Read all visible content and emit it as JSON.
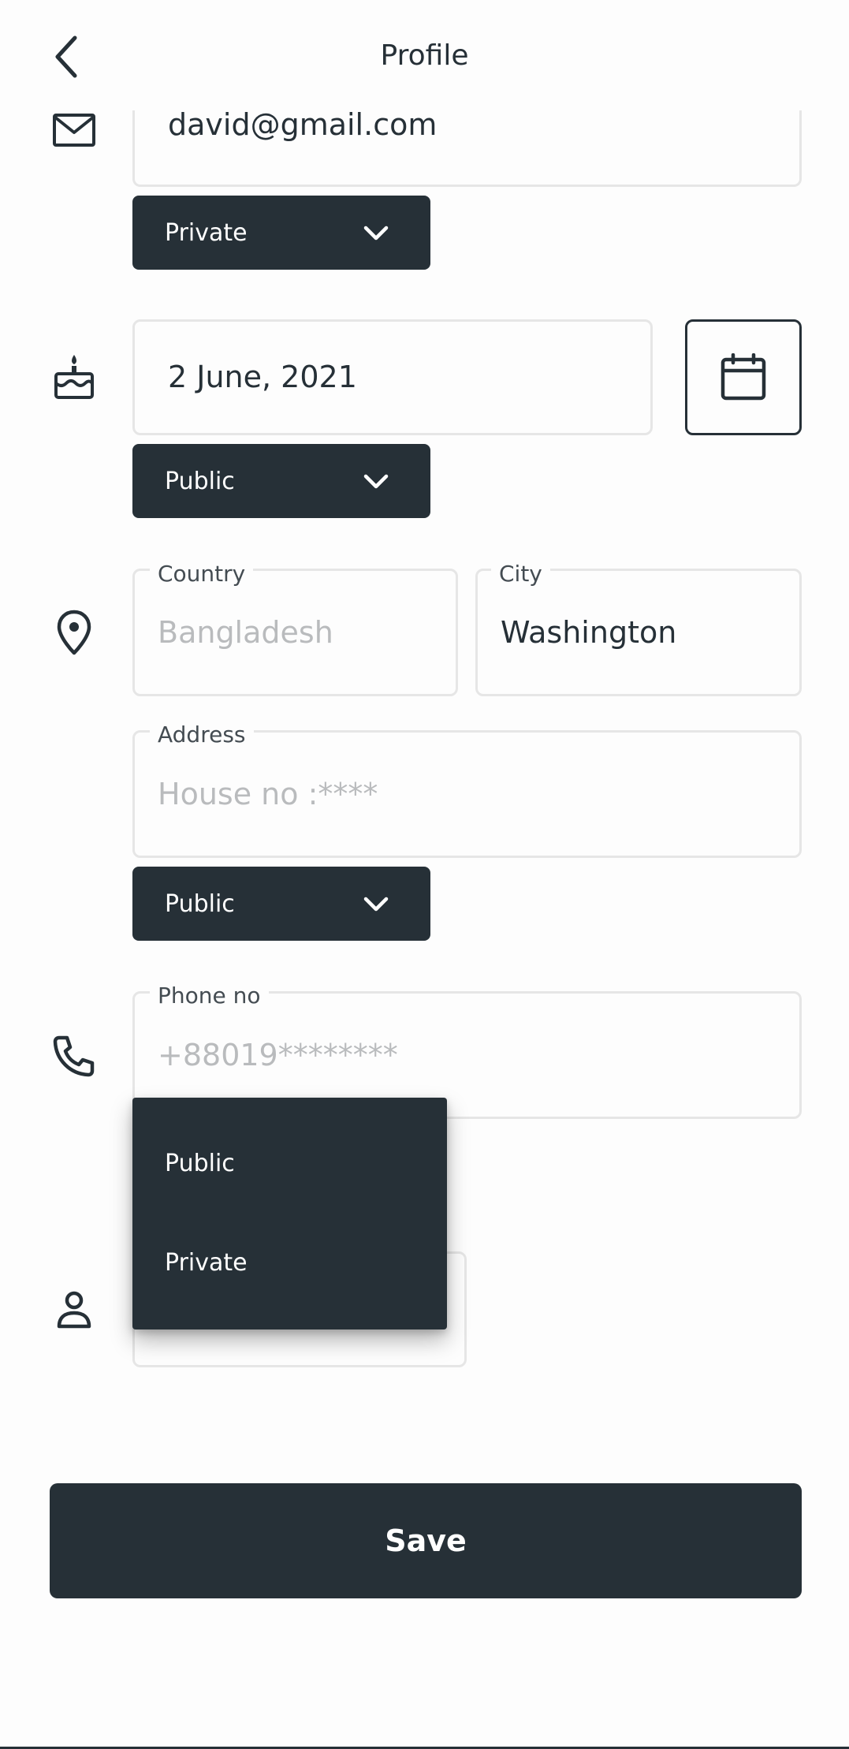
{
  "header": {
    "title": "Profile",
    "back_icon": "chevron-left-icon"
  },
  "email": {
    "value": "david@gmail.com",
    "visibility": "Private"
  },
  "birthday": {
    "value": "2 June, 2021",
    "visibility": "Public"
  },
  "location": {
    "country_label": "Country",
    "country_placeholder": "Bangladesh",
    "city_label": "City",
    "city_value": "Washington",
    "address_label": "Address",
    "address_placeholder": "House no :****",
    "visibility": "Public"
  },
  "phone": {
    "label": "Phone no",
    "placeholder": "+88019********"
  },
  "visibility_menu": {
    "options": [
      "Public",
      "Private"
    ]
  },
  "save_label": "Save",
  "colors": {
    "primary": "#263037",
    "border": "#e6e6e6",
    "placeholder": "#b9bbbd",
    "background": "#fdfdfd"
  }
}
